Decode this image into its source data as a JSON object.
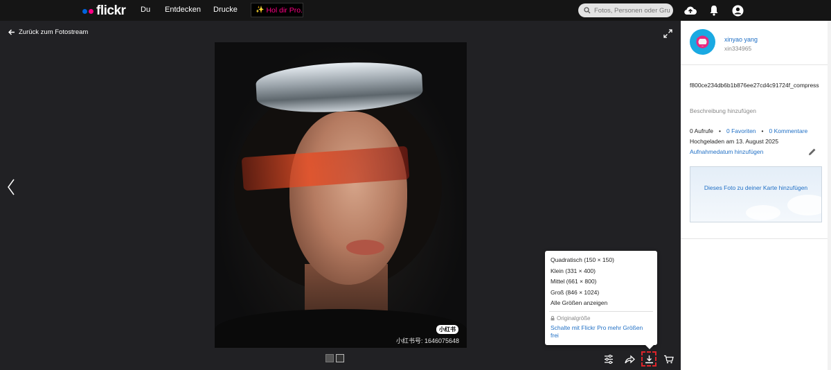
{
  "header": {
    "logo_text": "flickr",
    "nav": [
      "Du",
      "Entdecken",
      "Drucke"
    ],
    "pro_label": "Hol dir Pro.",
    "search_placeholder": "Fotos, Personen oder Gruppen"
  },
  "viewer": {
    "back_label": "Zurück zum Fotostream",
    "watermark_badge": "小红书",
    "watermark_text": "小红书号: 1646075648"
  },
  "download_menu": {
    "items": [
      "Quadratisch (150 × 150)",
      "Klein (331 × 400)",
      "Mittel (661 × 800)",
      "Groß (846 × 1024)",
      "Alle Größen anzeigen"
    ],
    "original_label": "Originalgröße",
    "pro_link": "Schalte mit Flickr Pro mehr Größen frei"
  },
  "sidebar": {
    "username": "xinyao yang",
    "handle": "xin334965",
    "photo_title": "f800ce234db6b1b876ee27cd4c91724f_compress",
    "add_description": "Beschreibung hinzufügen",
    "views": "0 Aufrufe",
    "favorites": "0 Favoriten",
    "comments": "0 Kommentare",
    "uploaded": "Hochgeladen am 13. August 2025",
    "add_date": "Aufnahmedatum hinzufügen",
    "map_label": "Dieses Foto zu deiner Karte hinzufügen"
  },
  "colors": {
    "brand_blue": "#0063dc",
    "brand_pink": "#ff0084",
    "link": "#1f6fc5",
    "highlight": "#e0242a"
  }
}
